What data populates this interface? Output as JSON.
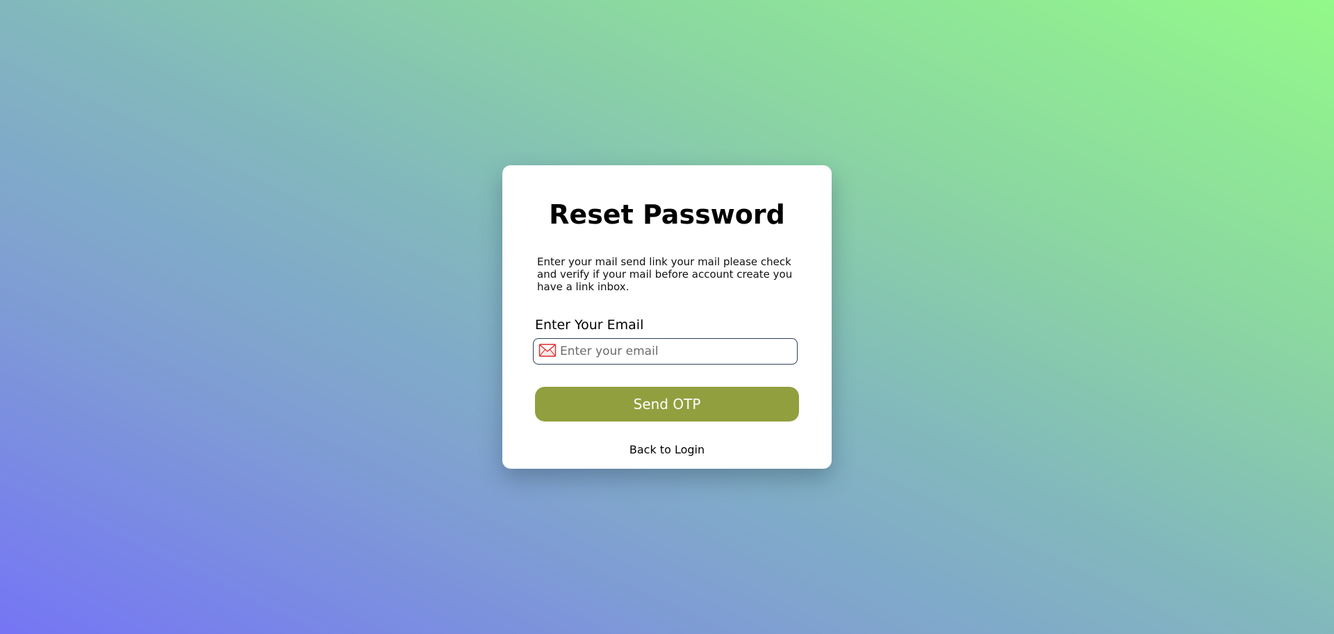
{
  "page": {
    "title": "Reset Password",
    "description": "Enter your mail send link your mail please check and verify if your mail before account create you have a link inbox."
  },
  "form": {
    "email_label": "Enter Your Email",
    "email_placeholder": "Enter your email",
    "email_value": "",
    "email_icon": "envelope-icon",
    "submit_label": "Send OTP",
    "back_link_label": "Back to Login"
  },
  "colors": {
    "button": "#929f3f",
    "input_border": "#2b4058",
    "icon": "#e02b2b",
    "gradient_start": "#7575f5",
    "gradient_end": "#93f989"
  }
}
